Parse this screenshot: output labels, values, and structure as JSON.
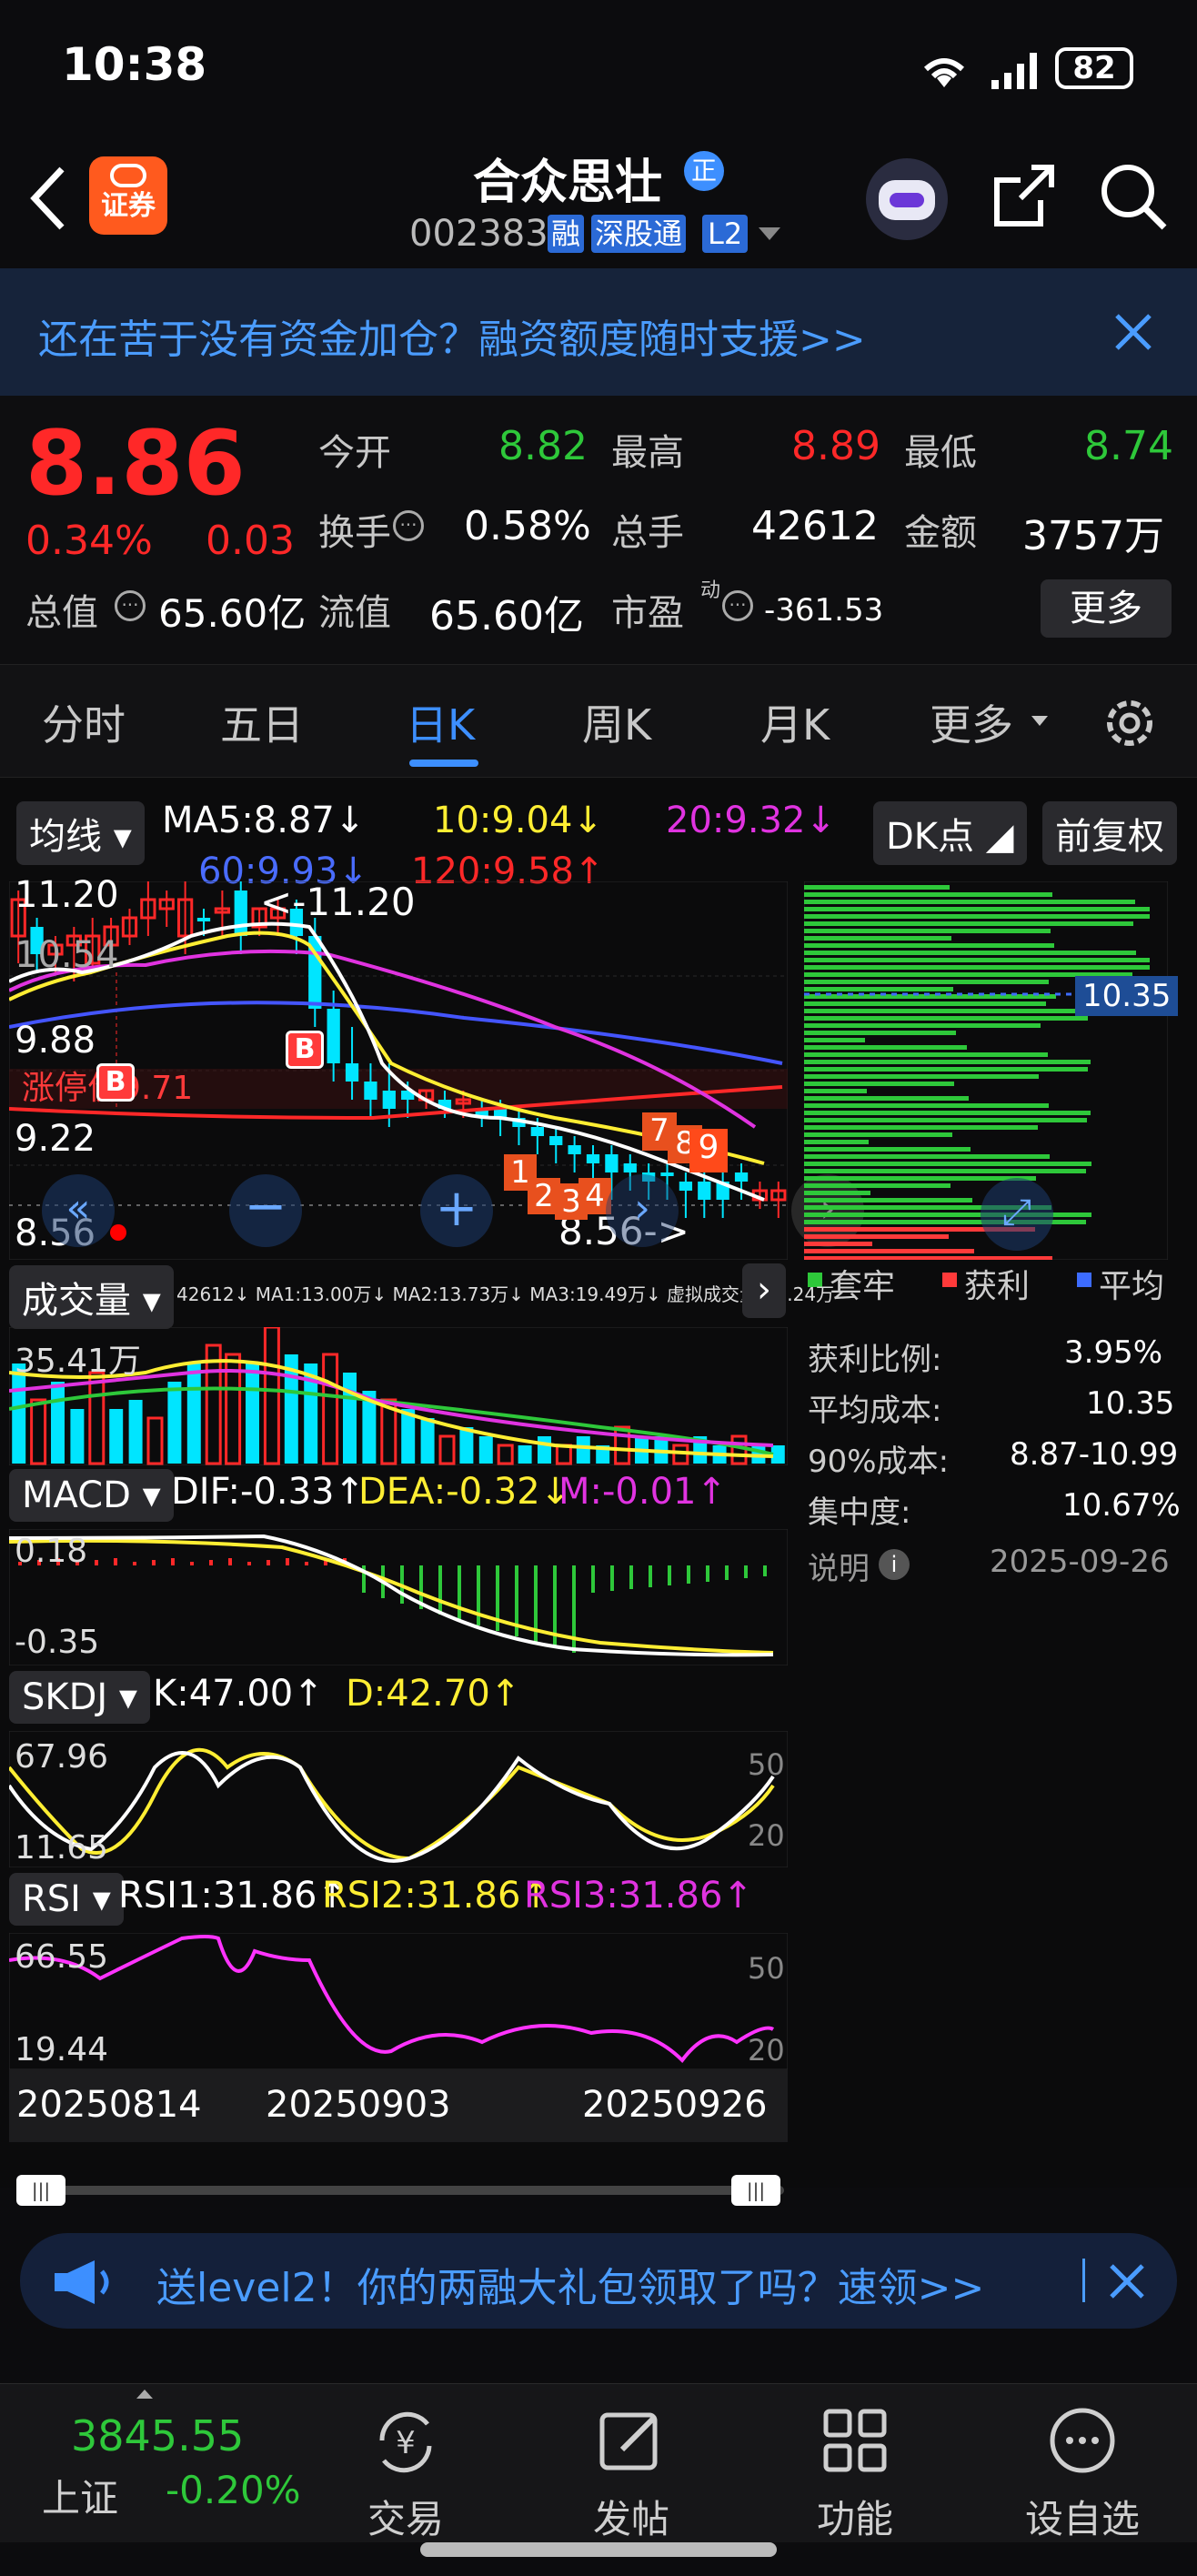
{
  "status_bar": {
    "time": "10:38",
    "battery": "82"
  },
  "header": {
    "title": "合众思壮",
    "code": "002383",
    "badges": [
      "融",
      "深股通",
      "L2"
    ],
    "app_badge": "证券",
    "verified_badge": "正"
  },
  "promo_banner": {
    "text": "还在苦于没有资金加仓？融资额度随时支援>>"
  },
  "quote": {
    "price": "8.86",
    "change_pct": "0.34%",
    "change": "0.03",
    "open_label": "今开",
    "open": "8.82",
    "high_label": "最高",
    "high": "8.89",
    "low_label": "最低",
    "low": "8.74",
    "turnover_label": "换手",
    "turnover": "0.58%",
    "volume_label": "总手",
    "volume": "42612",
    "amount_label": "金额",
    "amount": "3757万",
    "mktcap_label": "总值",
    "mktcap": "65.60亿",
    "float_label": "流值",
    "float": "65.60亿",
    "pe_label": "市盈",
    "pe_sup": "动",
    "pe": "-361.53",
    "more_button": "更多"
  },
  "tabs": [
    "分时",
    "五日",
    "日K",
    "周K",
    "月K",
    "更多"
  ],
  "active_tab": 2,
  "ma_bar": {
    "selector": "均线",
    "ma5": "MA5:8.87↓",
    "ma10": "10:9.04↓",
    "ma20": "20:9.32↓",
    "ma60": "60:9.93↓",
    "ma120": "120:9.58↑",
    "dk_button": "DK点",
    "adjust_button": "前复权"
  },
  "kline": {
    "y_labels": [
      "11.20",
      "10.54",
      "9.88",
      "9.22",
      "8.56"
    ],
    "max_annotation": "<-11.20",
    "min_annotation": "8.56->",
    "limit_label": "涨停价9.71",
    "signal_nums": [
      "1",
      "2",
      "3",
      "4",
      "7",
      "8",
      "9"
    ],
    "b_marker": "B"
  },
  "chip": {
    "avg_price_tag": "10.35",
    "legend": [
      "套牢",
      "获利",
      "平均"
    ],
    "rows": [
      {
        "label": "获利比例:",
        "value": "3.95%"
      },
      {
        "label": "平均成本:",
        "value": "10.35"
      },
      {
        "label": "90%成本:",
        "value": "8.87-10.99"
      },
      {
        "label": "集中度:",
        "value": "10.67%"
      }
    ],
    "note_label": "说明",
    "date": "2025-09-26"
  },
  "volume": {
    "selector": "成交量",
    "values": "42612↓  MA1:13.00万↓  MA2:13.73万↓  MA3:19.49万↓  虚拟成交量:10.24万",
    "y_label": "35.41万"
  },
  "macd": {
    "selector": "MACD",
    "dif": "DIF:-0.33↑",
    "dea": "DEA:-0.32↓",
    "m": "M:-0.01↑",
    "y_labels": [
      "0.18",
      "-0.35"
    ]
  },
  "skdj": {
    "selector": "SKDJ",
    "k": "K:47.00↑",
    "d": "D:42.70↑",
    "y_labels": [
      "67.96",
      "11.65"
    ],
    "ref": [
      "50",
      "20"
    ]
  },
  "rsi": {
    "selector": "RSI",
    "rsi1": "RSI1:31.86↑",
    "rsi2": "RSI2:31.86↑",
    "rsi3": "RSI3:31.86↑",
    "y_labels": [
      "66.55",
      "19.44"
    ],
    "ref": [
      "50",
      "20"
    ]
  },
  "dates": [
    "20250814",
    "20250903",
    "20250926"
  ],
  "bottom_banner": {
    "text": "送level2！你的两融大礼包领取了吗？速领>>"
  },
  "bottom_nav": {
    "index_value": "3845.55",
    "index_name": "上证",
    "index_change": "-0.20%",
    "items": [
      "交易",
      "发帖",
      "功能",
      "设自选"
    ]
  },
  "colors": {
    "up": "#ff2828",
    "down": "#00e5ff",
    "accent": "#3d8fff",
    "ma5": "#ffffff",
    "ma10": "#ffee33",
    "ma20": "#e033e0",
    "ma60": "#4455ff",
    "ma120": "#ff2828"
  }
}
